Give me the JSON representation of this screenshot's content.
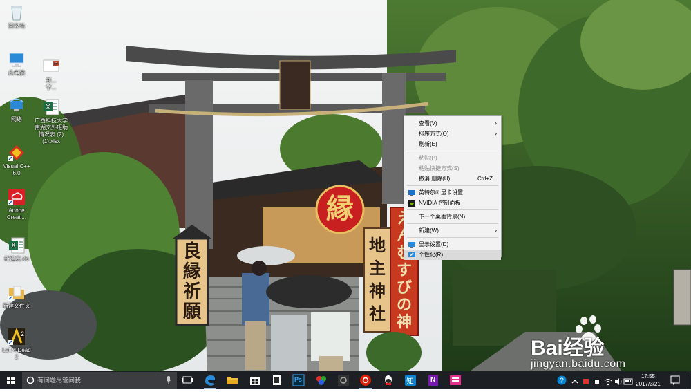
{
  "desktop": {
    "icons": [
      {
        "label": "回收站",
        "icon": "recycle-bin-icon"
      },
      {
        "label": "此电脑",
        "icon": "computer-icon"
      },
      {
        "label": "网络",
        "icon": "network-icon"
      },
      {
        "label": "Visual C++\n6.0",
        "icon": "visual-cpp-icon"
      },
      {
        "label": "Adobe\nCreati...",
        "icon": "adobe-creative-cloud-icon"
      },
      {
        "label": "新建表.xls",
        "icon": "excel-file-icon"
      },
      {
        "label": "新建文件夹",
        "icon": "folder-icon"
      },
      {
        "label": "Left 4 Dead\n2",
        "icon": "left4dead2-icon"
      },
      {
        "label": "新...\n学...",
        "icon": "powerpoint-file-icon"
      },
      {
        "label": "广西科技大学\n南湖文外班助\n情况表 (2)\n(1).xlsx",
        "icon": "excel-file-icon"
      }
    ]
  },
  "context_menu": {
    "items": [
      {
        "label": "查看(V)",
        "submenu": true,
        "enabled": true
      },
      {
        "label": "排序方式(O)",
        "submenu": true,
        "enabled": true
      },
      {
        "label": "刷新(E)",
        "enabled": true
      },
      {
        "sep": true
      },
      {
        "label": "粘贴(P)",
        "enabled": false
      },
      {
        "label": "粘贴快捷方式(S)",
        "enabled": false
      },
      {
        "label": "撤消 删除(U)",
        "shortcut": "Ctrl+Z",
        "enabled": true
      },
      {
        "sep": true
      },
      {
        "label": "英特尔® 显卡设置",
        "enabled": true,
        "icon": "intel-graphics-icon"
      },
      {
        "label": "NVIDIA 控制面板",
        "enabled": true,
        "icon": "nvidia-icon"
      },
      {
        "sep": true
      },
      {
        "label": "下一个桌面背景(N)",
        "enabled": true
      },
      {
        "sep": true
      },
      {
        "label": "新建(W)",
        "submenu": true,
        "enabled": true
      },
      {
        "sep": true
      },
      {
        "label": "显示设置(D)",
        "enabled": true,
        "icon": "display-settings-icon"
      },
      {
        "label": "个性化(R)",
        "enabled": true,
        "icon": "personalize-icon",
        "highlighted": true
      }
    ]
  },
  "taskbar": {
    "search_placeholder": "有问题尽管问我",
    "apps": [
      {
        "name": "task-view-icon"
      },
      {
        "name": "edge-icon"
      },
      {
        "name": "file-explorer-icon"
      },
      {
        "name": "store-icon"
      },
      {
        "name": "kindle-icon"
      },
      {
        "name": "photoshop-icon"
      },
      {
        "name": "paint-app-icon"
      },
      {
        "name": "camera-app-icon"
      },
      {
        "name": "netease-music-icon"
      },
      {
        "name": "qq-icon"
      },
      {
        "name": "zhihu-icon"
      },
      {
        "name": "onenote-icon"
      },
      {
        "name": "reader-app-icon"
      }
    ],
    "app_labels": {
      "photoshop": "Ps",
      "zhihu": "知",
      "onenote": "N"
    },
    "clock": {
      "time": "17:55",
      "date": "2017/3/21"
    }
  },
  "wallpaper": {
    "sign_kanji": "縁",
    "lantern_left": "良縁祈願",
    "banner_right": "地主神社",
    "banner_red": "えんむすびの神"
  },
  "watermark": {
    "brand": "Bai经验",
    "url": "jingyan.baidu.com"
  },
  "colors": {
    "taskbar": "#1c1f24",
    "menu_bg": "#f2f2f2",
    "menu_highlight": "#dadada",
    "accent": "#0078d7"
  }
}
